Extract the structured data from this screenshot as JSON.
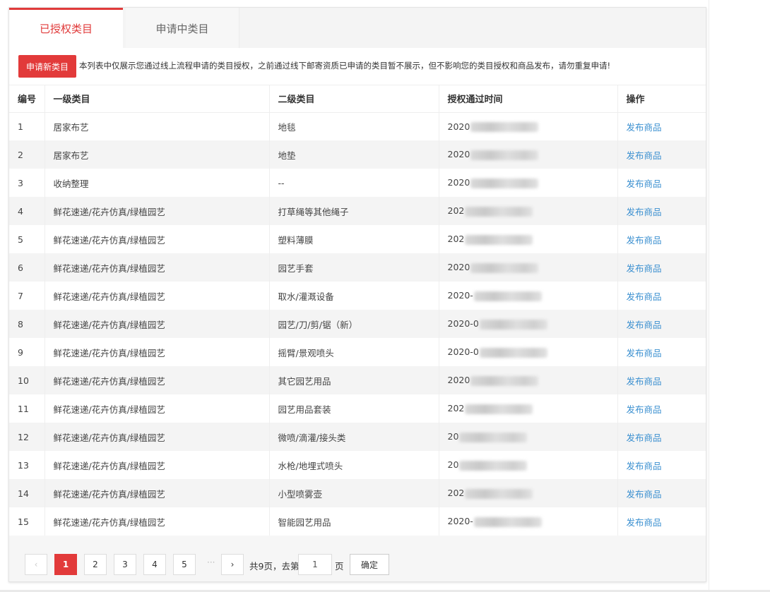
{
  "tabs": [
    {
      "label": "已授权类目",
      "active": true
    },
    {
      "label": "申请中类目",
      "active": false
    }
  ],
  "notice": {
    "apply_button": "申请新类目",
    "text": "本列表中仅展示您通过线上流程申请的类目授权，之前通过线下邮寄资质已申请的类目暂不展示，但不影响您的类目授权和商品发布，请勿重复申请!"
  },
  "table": {
    "headers": [
      "编号",
      "一级类目",
      "二级类目",
      "授权通过时间",
      "操作"
    ],
    "rows": [
      {
        "no": "1",
        "cat1": "居家布艺",
        "cat2": "地毯",
        "time": "2020",
        "op": "发布商品"
      },
      {
        "no": "2",
        "cat1": "居家布艺",
        "cat2": "地垫",
        "time": "2020",
        "op": "发布商品"
      },
      {
        "no": "3",
        "cat1": "收纳整理",
        "cat2": "--",
        "time": "2020",
        "op": "发布商品"
      },
      {
        "no": "4",
        "cat1": "鲜花速递/花卉仿真/绿植园艺",
        "cat2": "打草绳等其他绳子",
        "time": "202",
        "op": "发布商品"
      },
      {
        "no": "5",
        "cat1": "鲜花速递/花卉仿真/绿植园艺",
        "cat2": "塑料薄膜",
        "time": "202",
        "op": "发布商品"
      },
      {
        "no": "6",
        "cat1": "鲜花速递/花卉仿真/绿植园艺",
        "cat2": "园艺手套",
        "time": "2020",
        "op": "发布商品"
      },
      {
        "no": "7",
        "cat1": "鲜花速递/花卉仿真/绿植园艺",
        "cat2": "取水/灌溉设备",
        "time": "2020-",
        "op": "发布商品"
      },
      {
        "no": "8",
        "cat1": "鲜花速递/花卉仿真/绿植园艺",
        "cat2": "园艺/刀/剪/锯（新）",
        "time": "2020-0",
        "op": "发布商品"
      },
      {
        "no": "9",
        "cat1": "鲜花速递/花卉仿真/绿植园艺",
        "cat2": "摇臂/景观喷头",
        "time": "2020-0",
        "op": "发布商品"
      },
      {
        "no": "10",
        "cat1": "鲜花速递/花卉仿真/绿植园艺",
        "cat2": "其它园艺用品",
        "time": "2020",
        "op": "发布商品"
      },
      {
        "no": "11",
        "cat1": "鲜花速递/花卉仿真/绿植园艺",
        "cat2": "园艺用品套装",
        "time": "202",
        "op": "发布商品"
      },
      {
        "no": "12",
        "cat1": "鲜花速递/花卉仿真/绿植园艺",
        "cat2": "微喷/滴灌/接头类",
        "time": "20",
        "op": "发布商品"
      },
      {
        "no": "13",
        "cat1": "鲜花速递/花卉仿真/绿植园艺",
        "cat2": "水枪/地埋式喷头",
        "time": "20",
        "op": "发布商品"
      },
      {
        "no": "14",
        "cat1": "鲜花速递/花卉仿真/绿植园艺",
        "cat2": "小型喷雾壶",
        "time": "202",
        "op": "发布商品"
      },
      {
        "no": "15",
        "cat1": "鲜花速递/花卉仿真/绿植园艺",
        "cat2": "智能园艺用品",
        "time": "2020-",
        "op": "发布商品"
      }
    ]
  },
  "pagination": {
    "prev": "‹",
    "pages": [
      "1",
      "2",
      "3",
      "4",
      "5"
    ],
    "current": "1",
    "ellipsis": "···",
    "next": "›",
    "total_text": "共9页，去第",
    "goto_value": "1",
    "page_suffix": "页",
    "confirm": "确定"
  },
  "colors": {
    "accent": "#e23a3a",
    "link": "#3a8fd0"
  }
}
